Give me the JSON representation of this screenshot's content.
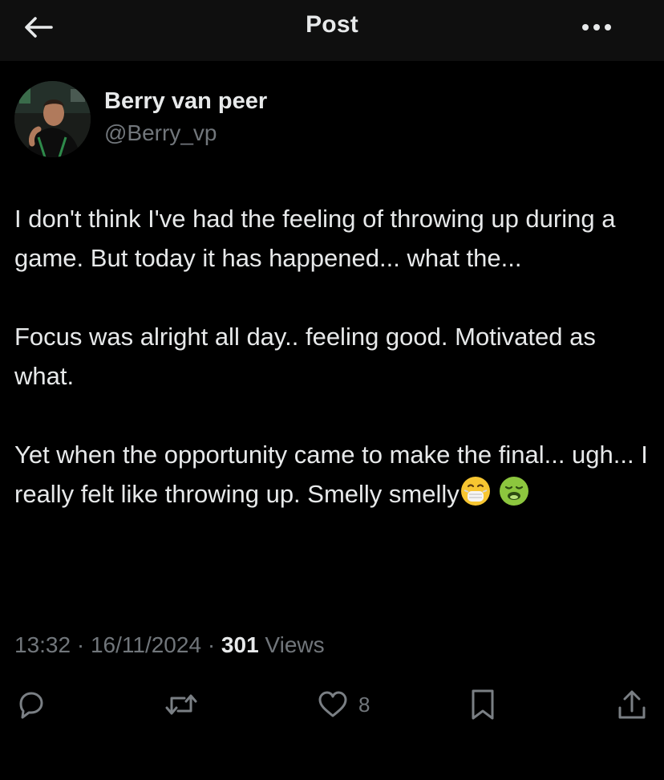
{
  "header": {
    "title": "Post",
    "back_icon": "arrow-left-icon",
    "more_icon": "more-horizontal-icon"
  },
  "author": {
    "display_name": "Berry van peer",
    "handle": "@Berry_vp",
    "avatar_icon": "avatar-photo"
  },
  "tweet": {
    "paragraphs": [
      "I don't think I've had the feeling of throwing up during a game. But today it has happened... what the...",
      "Focus was alright all day.. feeling good. Motivated as what.",
      "Yet when the opportunity came to make the final... ugh... I really felt like throwing up. Smelly smelly"
    ],
    "emojis": [
      "face-with-medical-mask-icon",
      "nauseated-face-icon"
    ]
  },
  "meta": {
    "time": "13:32",
    "date": "16/11/2024",
    "separator": "·",
    "views_count": "301",
    "views_label": "Views"
  },
  "actions": {
    "reply_icon": "reply-icon",
    "repost_icon": "repost-icon",
    "like_icon": "heart-icon",
    "like_count": "8",
    "bookmark_icon": "bookmark-icon",
    "share_icon": "share-icon"
  },
  "colors": {
    "background": "#000000",
    "header_background": "#0f0f0f",
    "text_primary": "#e7e9ea",
    "text_secondary": "#71767b"
  }
}
